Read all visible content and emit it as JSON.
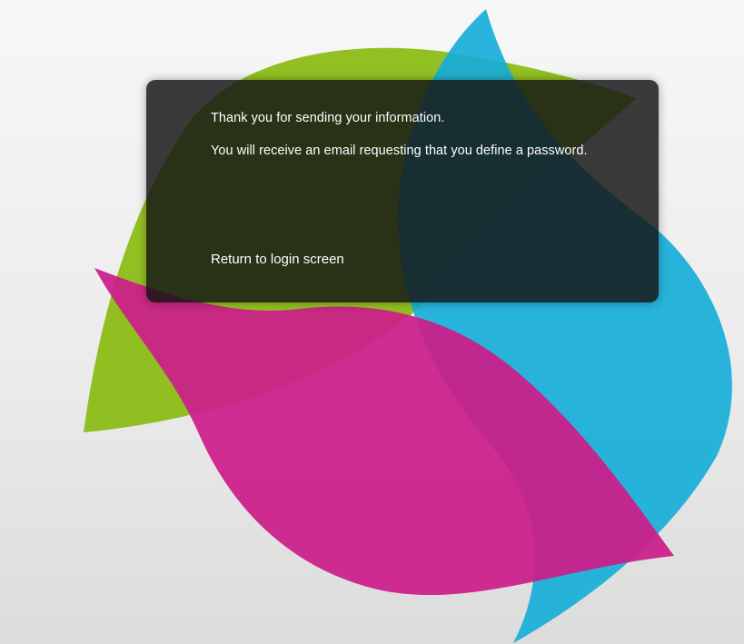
{
  "colors": {
    "background": "#eeeeee",
    "green_petal": "#8cbd16",
    "cyan_petal": "#17aed9",
    "magenta_petal": "#cc1d8a",
    "dialog_bg": "#161616",
    "text": "#ffffff"
  },
  "dialog": {
    "message_1": "Thank you for sending your information.",
    "message_2": "You will receive an email requesting that you define a password.",
    "return_link": "Return to login screen"
  }
}
